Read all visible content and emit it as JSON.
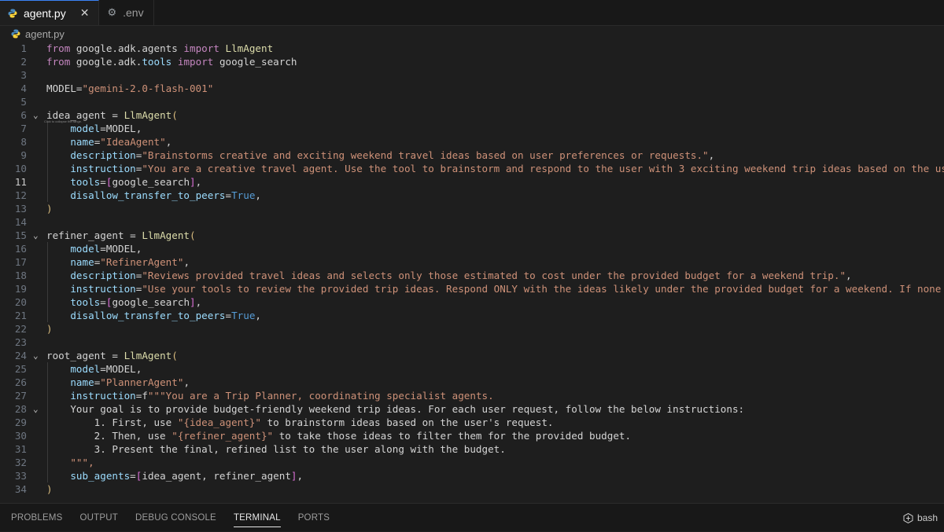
{
  "tabs": [
    {
      "label": "agent.py",
      "icon": "python-file-icon",
      "active": true,
      "close": "✕"
    },
    {
      "label": ".env",
      "icon": "gear-icon",
      "active": false
    }
  ],
  "breadcrumb": {
    "file": "agent.py"
  },
  "editor": {
    "current_line": 11,
    "fold_tooltip": "Click to collapse the range.",
    "lines": [
      {
        "n": "1",
        "text": "from google.adk.agents import LlmAgent"
      },
      {
        "n": "2",
        "text": "from google.adk.tools import google_search"
      },
      {
        "n": "3",
        "text": ""
      },
      {
        "n": "4",
        "text": "MODEL=\"gemini-2.0-flash-001\""
      },
      {
        "n": "5",
        "text": ""
      },
      {
        "n": "6",
        "text": "idea_agent = LlmAgent("
      },
      {
        "n": "7",
        "text": "    model=MODEL,"
      },
      {
        "n": "8",
        "text": "    name=\"IdeaAgent\","
      },
      {
        "n": "9",
        "text": "    description=\"Brainstorms creative and exciting weekend travel ideas based on user preferences or requests.\","
      },
      {
        "n": "10",
        "text": "    instruction=\"You are a creative travel agent. Use the tool to brainstorm and respond to the user with 3 exciting weekend trip ideas based on the user's request.\","
      },
      {
        "n": "11",
        "text": "    tools=[google_search],"
      },
      {
        "n": "12",
        "text": "    disallow_transfer_to_peers=True,"
      },
      {
        "n": "13",
        "text": ")"
      },
      {
        "n": "14",
        "text": ""
      },
      {
        "n": "15",
        "text": "refiner_agent = LlmAgent("
      },
      {
        "n": "16",
        "text": "    model=MODEL,"
      },
      {
        "n": "17",
        "text": "    name=\"RefinerAgent\","
      },
      {
        "n": "18",
        "text": "    description=\"Reviews provided travel ideas and selects only those estimated to cost under the provided budget for a weekend trip.\","
      },
      {
        "n": "19",
        "text": "    instruction=\"Use your tools to review the provided trip ideas. Respond ONLY with the ideas likely under the provided budget for a weekend. If none seem to fit, say"
      },
      {
        "n": "20",
        "text": "    tools=[google_search],"
      },
      {
        "n": "21",
        "text": "    disallow_transfer_to_peers=True,"
      },
      {
        "n": "22",
        "text": ")"
      },
      {
        "n": "23",
        "text": ""
      },
      {
        "n": "24",
        "text": "root_agent = LlmAgent("
      },
      {
        "n": "25",
        "text": "    model=MODEL,"
      },
      {
        "n": "26",
        "text": "    name=\"PlannerAgent\","
      },
      {
        "n": "27",
        "text": "    instruction=f\"\"\"You are a Trip Planner, coordinating specialist agents."
      },
      {
        "n": "28",
        "text": "    Your goal is to provide budget-friendly weekend trip ideas. For each user request, follow the below instructions:"
      },
      {
        "n": "29",
        "text": "        1. First, use \"{idea_agent}\" to brainstorm ideas based on the user's request."
      },
      {
        "n": "30",
        "text": "        2. Then, use \"{refiner_agent}\" to take those ideas to filter them for the provided budget."
      },
      {
        "n": "31",
        "text": "        3. Present the final, refined list to the user along with the budget."
      },
      {
        "n": "32",
        "text": "    \"\"\","
      },
      {
        "n": "33",
        "text": "    sub_agents=[idea_agent, refiner_agent],"
      },
      {
        "n": "34",
        "text": ")"
      }
    ]
  },
  "panel": {
    "tabs": [
      "PROBLEMS",
      "OUTPUT",
      "DEBUG CONSOLE",
      "TERMINAL",
      "PORTS"
    ],
    "active": "TERMINAL",
    "shell_label": "bash"
  }
}
